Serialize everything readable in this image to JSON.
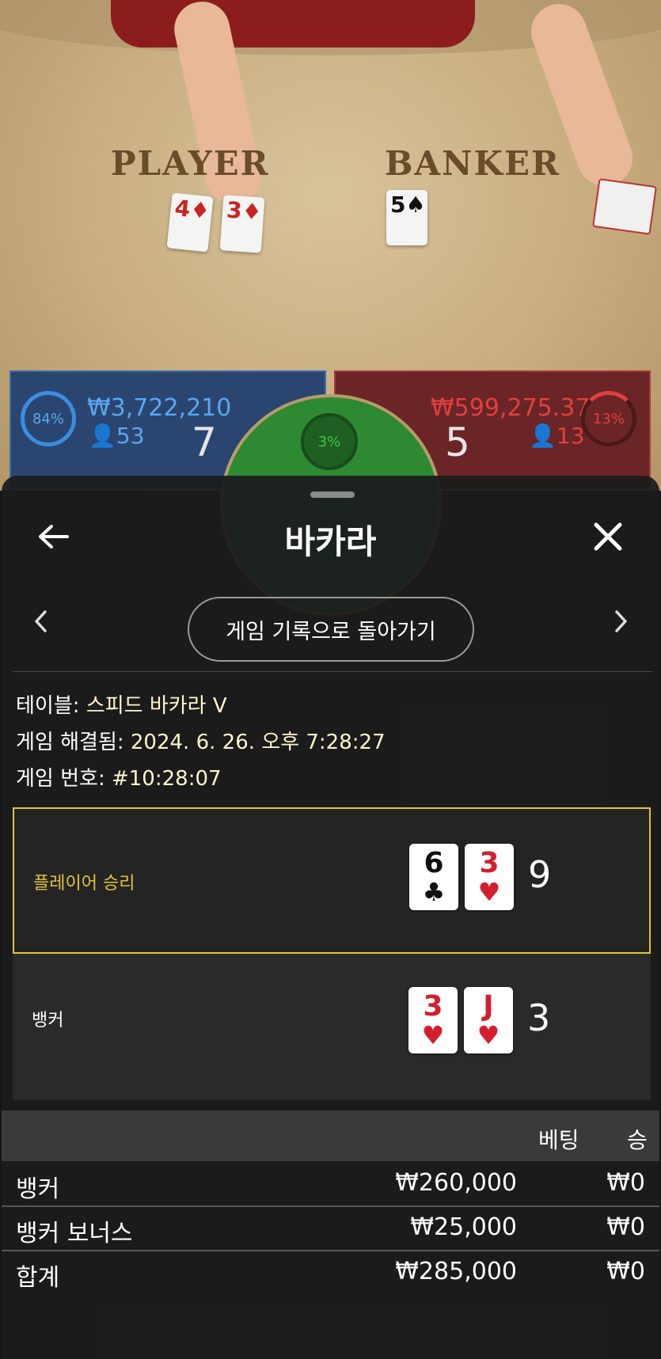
{
  "scene": {
    "player_label": "PLAYER",
    "banker_label": "BANKER",
    "player_cards": [
      {
        "rank": "4",
        "suit": "♦"
      },
      {
        "rank": "3",
        "suit": "♦"
      }
    ],
    "banker_cards": [
      {
        "rank": "5",
        "suit": "♠"
      }
    ],
    "player_panel": {
      "percent": "84%",
      "amount": "₩3,722,210",
      "players": "53",
      "score": "7"
    },
    "banker_panel": {
      "percent": "13%",
      "amount": "₩599,275.37",
      "players": "13",
      "score": "5"
    },
    "tie_percent": "3%",
    "colors": {
      "player": "#2a4670",
      "banker": "#6b2526",
      "tie": "#2e8a32"
    }
  },
  "sheet": {
    "title": "바카라",
    "back_icon": "arrow-left-icon",
    "close_icon": "close-icon",
    "history_button": "게임 기록으로 돌아가기",
    "info": {
      "table_label": "테이블:",
      "table_value": "스피드 바카라 V",
      "resolved_label": "게임 해결됨:",
      "resolved_value": "2024. 6. 26. 오후 7:28:27",
      "number_label": "게임 번호:",
      "number_value": "#10:28:07"
    },
    "results": [
      {
        "label": "플레이어 승리",
        "winner": true,
        "cards": [
          {
            "rank": "6",
            "suit": "♣",
            "color": "black"
          },
          {
            "rank": "3",
            "suit": "♥",
            "color": "red"
          }
        ],
        "total": "9"
      },
      {
        "label": "뱅커",
        "winner": false,
        "cards": [
          {
            "rank": "3",
            "suit": "♥",
            "color": "red"
          },
          {
            "rank": "J",
            "suit": "♥",
            "color": "red"
          }
        ],
        "total": "3"
      }
    ],
    "table_headers": {
      "bet": "베팅",
      "win": "승"
    },
    "bets": [
      {
        "name": "뱅커",
        "bet": "₩260,000",
        "win": "₩0"
      },
      {
        "name": "뱅커 보너스",
        "bet": "₩25,000",
        "win": "₩0"
      },
      {
        "name": "합계",
        "bet": "₩285,000",
        "win": "₩0"
      }
    ],
    "accent_color": "#e0c43a"
  }
}
